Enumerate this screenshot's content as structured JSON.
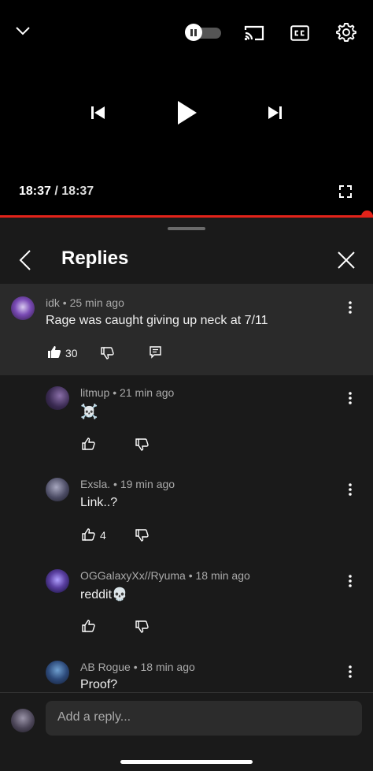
{
  "player": {
    "current_time": "18:37",
    "separator": "/",
    "duration": "18:37",
    "progress_fraction": 1.0,
    "accent_color": "#e2231a",
    "autoplay": "off"
  },
  "panel": {
    "title": "Replies"
  },
  "parent_comment": {
    "author": "idk",
    "time": "25 min ago",
    "text": "Rage was caught giving up neck at 7/11",
    "likes": "30"
  },
  "replies": [
    {
      "author": "litmup",
      "time": "21 min ago",
      "text": "☠️",
      "likes": ""
    },
    {
      "author": "Exsla.",
      "time": "19 min ago",
      "text": "Link..?",
      "likes": "4"
    },
    {
      "author": "OGGalaxyXx//Ryuma",
      "time": "18 min ago",
      "text": "reddit💀",
      "likes": ""
    },
    {
      "author": "AB Rogue",
      "time": "18 min ago",
      "text": "Proof?",
      "likes": ""
    }
  ],
  "reply_box": {
    "placeholder": "Add a reply..."
  }
}
